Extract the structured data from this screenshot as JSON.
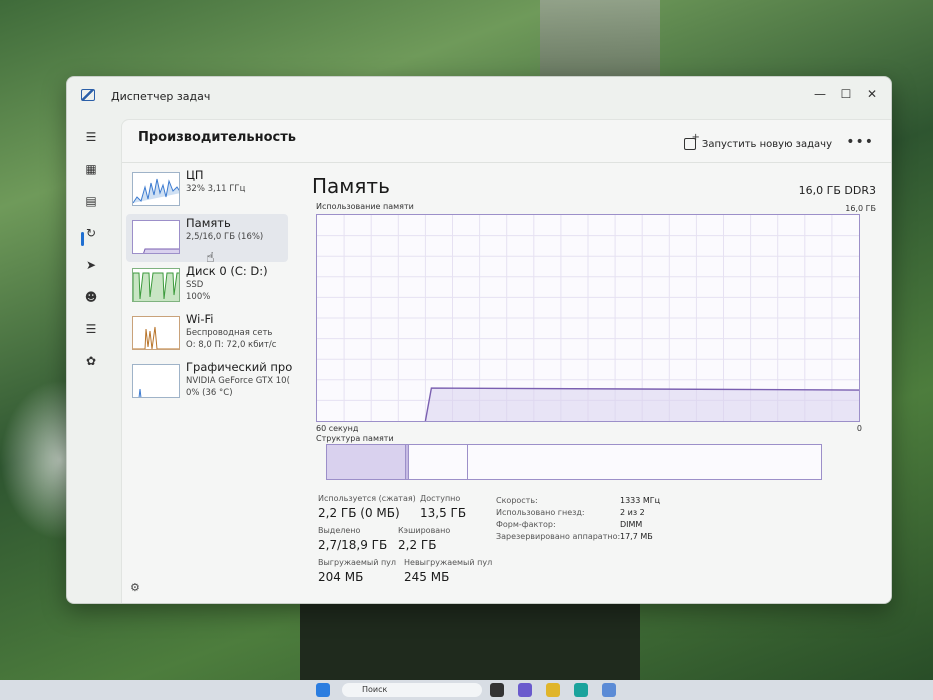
{
  "window": {
    "title": "Диспетчер задач",
    "controls": [
      "minimize",
      "maximize",
      "close"
    ]
  },
  "header": {
    "title": "Производительность",
    "run_task_label": "Запустить новую задачу",
    "more_label": "•••"
  },
  "nav": {
    "icons": [
      "menu-icon",
      "processes-icon",
      "performance-icon",
      "app-history-icon",
      "startup-icon",
      "users-icon",
      "details-icon",
      "services-icon",
      "settings-icon"
    ]
  },
  "sidebar": {
    "items": [
      {
        "name": "ЦП",
        "sub1": "32% 3,11 ГГц",
        "sub2": "",
        "sub3": ""
      },
      {
        "name": "Память",
        "sub1": "2,5/16,0 ГБ (16%)",
        "sub2": "",
        "sub3": ""
      },
      {
        "name": "Диск 0 (C: D:)",
        "sub1": "SSD",
        "sub2": "100%",
        "sub3": ""
      },
      {
        "name": "Wi-Fi",
        "sub1": "Беспроводная сеть",
        "sub2": "О: 8,0 П: 72,0 кбит/с",
        "sub3": ""
      },
      {
        "name": "Графический про",
        "sub1": "NVIDIA GeForce GTX 10(",
        "sub2": "0% (36 °C)",
        "sub3": ""
      }
    ],
    "selected_index": 1
  },
  "panel": {
    "title": "Память",
    "spec": "16,0 ГБ DDR3",
    "usage_label": "Использование памяти",
    "usage_max": "16,0 ГБ",
    "time_label": "60 секунд",
    "zero_label": "0",
    "structure_label": "Структура памяти",
    "usage_percent": 16,
    "structure": {
      "in_use_percent": 16,
      "modified_percent": 0.5,
      "standby_percent": 12
    }
  },
  "stats": {
    "in_use": {
      "label": "Используется (сжатая)",
      "value": "2,2 ГБ (0 МБ)"
    },
    "available": {
      "label": "Доступно",
      "value": "13,5 ГБ"
    },
    "committed": {
      "label": "Выделено",
      "value": "2,7/18,9 ГБ"
    },
    "cached": {
      "label": "Кэшировано",
      "value": "2,2 ГБ"
    },
    "paged_pool": {
      "label": "Выгружаемый пул",
      "value": "204 МБ"
    },
    "nonpaged_pool": {
      "label": "Невыгружаемый пул",
      "value": "245 МБ"
    }
  },
  "details": [
    {
      "label": "Скорость:",
      "value": "1333 МГц"
    },
    {
      "label": "Использовано гнезд:",
      "value": "2 из 2"
    },
    {
      "label": "Форм-фактор:",
      "value": "DIMM"
    },
    {
      "label": "Зарезервировано аппаратно:",
      "value": "17,7 МБ"
    }
  ],
  "taskbar": {
    "search_label": "Поиск"
  },
  "colors": {
    "accent": "#1f6fd1",
    "memory_line": "#7a5fb0",
    "memory_fill": "#d9d1ee",
    "cpu_line": "#3c7bd0",
    "disk_line": "#3c9a3c",
    "wifi_line": "#b8742a"
  }
}
